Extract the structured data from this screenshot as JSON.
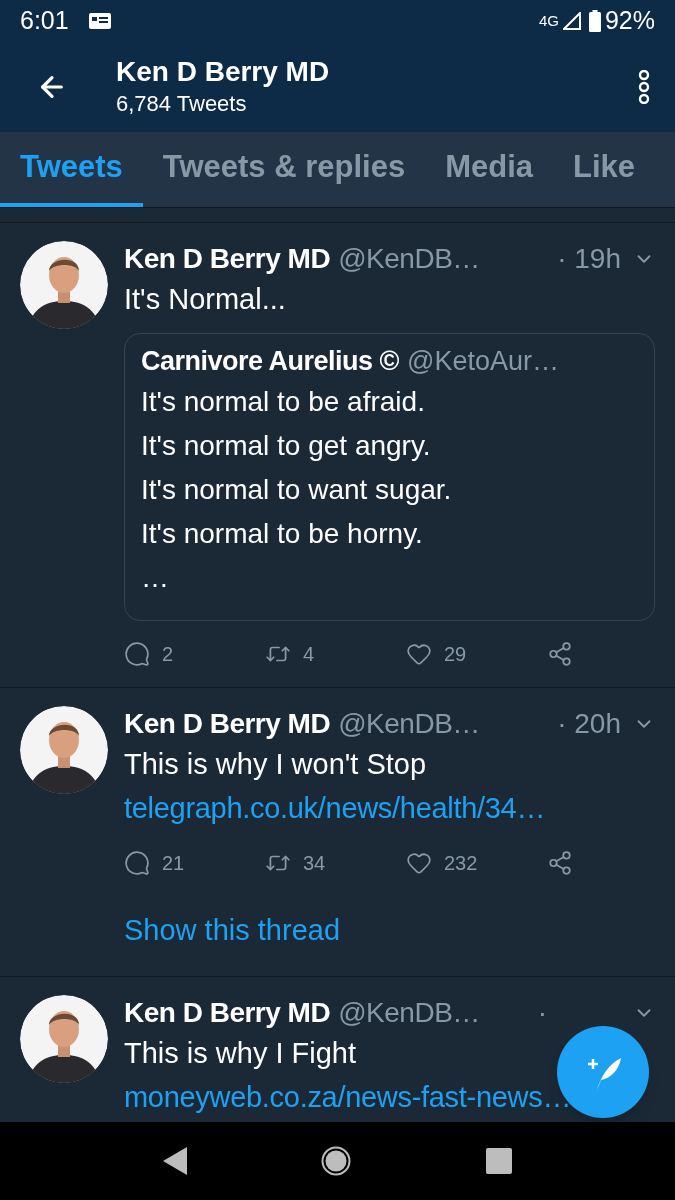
{
  "status_bar": {
    "time": "6:01",
    "network": "4G",
    "battery": "92%"
  },
  "header": {
    "title": "Ken D Berry MD",
    "subtitle": "6,784 Tweets"
  },
  "tabs": [
    {
      "label": "Tweets",
      "selected": true
    },
    {
      "label": "Tweets & replies",
      "selected": false
    },
    {
      "label": "Media",
      "selected": false
    },
    {
      "label": "Like",
      "selected": false
    }
  ],
  "tweets": [
    {
      "name": "Ken D Berry MD",
      "handle": "@KenDB…",
      "time": "· 19h",
      "text": "It's Normal...",
      "quote": {
        "name": "Carnivore Aurelius ©",
        "handle": "@KetoAur…",
        "lines": [
          "It's normal to be afraid.",
          "It's normal to get angry.",
          "It's normal to want sugar.",
          "It's normal to be horny.",
          "…"
        ]
      },
      "replies": "2",
      "retweets": "4",
      "likes": "29"
    },
    {
      "name": "Ken D Berry MD",
      "handle": "@KenDB…",
      "time": "· 20h",
      "text": "This is why I won't Stop",
      "link": "telegraph.co.uk/news/health/34…",
      "replies": "21",
      "retweets": "34",
      "likes": "232",
      "thread": "Show this thread"
    },
    {
      "name": "Ken D Berry MD",
      "handle": "@KenDB…",
      "time": "·",
      "text": "This is why I Fight",
      "link": "moneyweb.co.za/news-fast-news…"
    }
  ]
}
